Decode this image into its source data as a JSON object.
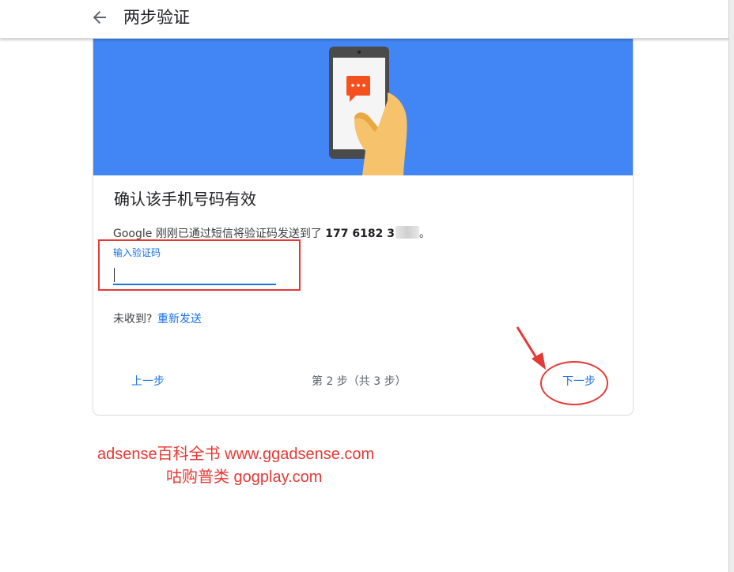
{
  "header": {
    "title": "两步验证",
    "back_icon": "arrow-left-icon"
  },
  "hero": {
    "background_color": "#4285f4",
    "illustration": "hand-holding-phone-with-message-icon",
    "message_icon_color": "#f4511e"
  },
  "card": {
    "title": "确认该手机号码有效",
    "description_prefix": "Google 刚刚已通过短信将验证码发送到了",
    "phone_number": "177 6182 3",
    "description_suffix": "。",
    "code_field": {
      "label": "输入验证码",
      "value": ""
    },
    "resend_prompt": "未收到?",
    "resend_link": "重新发送"
  },
  "footer": {
    "prev_label": "上一步",
    "step_indicator": "第 2 步（共 3 步）",
    "next_label": "下一步"
  },
  "annotations": {
    "watermark_line1": "adsense百科全书 www.ggadsense.com",
    "watermark_line2": "咕购普类 gogplay.com",
    "highlight_color": "#e53935"
  },
  "colors": {
    "accent": "#1a73e8",
    "text_primary": "#202124",
    "text_secondary": "#5f6368"
  }
}
